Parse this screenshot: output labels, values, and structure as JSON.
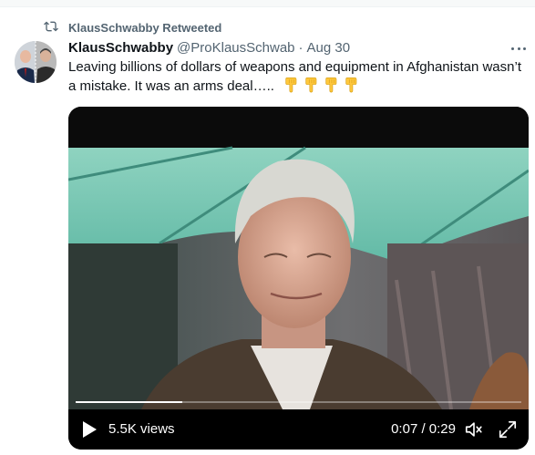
{
  "retweet": {
    "label": "KlausSchwabby Retweeted",
    "icon": "retweet-icon"
  },
  "author": {
    "display_name": "KlausSchwabby",
    "handle": "@ProKlausSchwab",
    "separator": "·",
    "date": "Aug 30"
  },
  "tweet": {
    "text": "Leaving billions of dollars of weapons and equipment in Afghanistan wasn’t a mistake. It was an arms deal….. ",
    "emojis": [
      "pointing-down-emoji",
      "pointing-down-emoji",
      "pointing-down-emoji",
      "pointing-down-emoji"
    ]
  },
  "video": {
    "views": "5.5K views",
    "time": "0:07 / 0:29",
    "progress": 0.24,
    "play_icon": "play-icon",
    "volume_icon": "volume-icon",
    "fullscreen_icon": "fullscreen-icon"
  },
  "colors": {
    "secondary_text": "#536471",
    "primary_text": "#0f1419",
    "emoji": "#ffc83d"
  }
}
